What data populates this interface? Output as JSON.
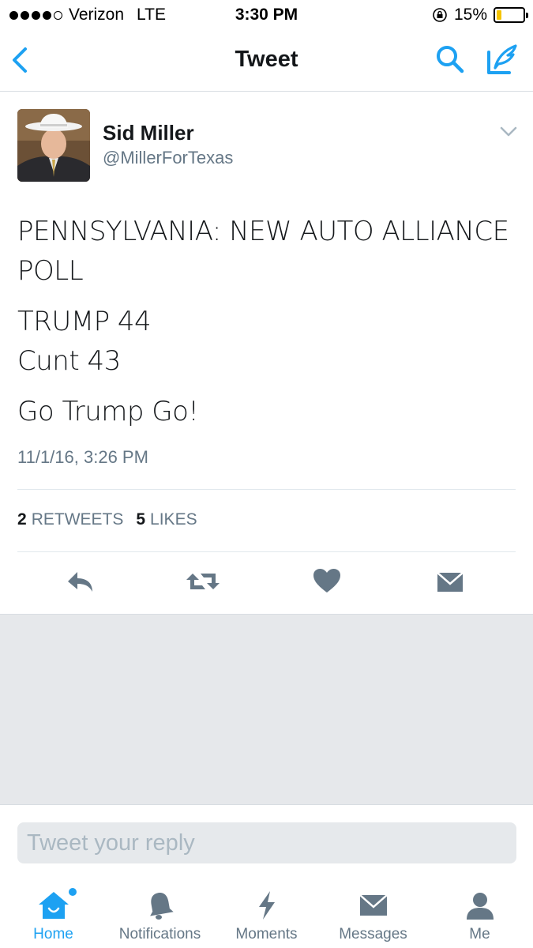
{
  "status_bar": {
    "carrier": "Verizon",
    "network": "LTE",
    "time": "3:30 PM",
    "battery": "15%",
    "battery_level": 0.15,
    "signal_bars": 4
  },
  "nav": {
    "title": "Tweet",
    "icons": [
      "back-chevron-icon",
      "search-icon",
      "compose-icon"
    ]
  },
  "tweet": {
    "author_name": "Sid Miller",
    "author_handle": "@MillerForTexas",
    "text_lines": [
      "PENNSYLVANIA: NEW AUTO ALLIANCE POLL",
      "TRUMP 44\nCunt 43",
      "Go Trump Go!"
    ],
    "timestamp": "11/1/16, 3:26 PM",
    "retweets_count": "2",
    "retweets_label": "RETWEETS",
    "likes_count": "5",
    "likes_label": "LIKES"
  },
  "reply": {
    "placeholder": "Tweet your reply"
  },
  "tab_bar": {
    "tabs": [
      {
        "label": "Home",
        "icon": "home-icon",
        "active": true
      },
      {
        "label": "Notifications",
        "icon": "bell-icon",
        "active": false
      },
      {
        "label": "Moments",
        "icon": "lightning-icon",
        "active": false
      },
      {
        "label": "Messages",
        "icon": "envelope-icon",
        "active": false
      },
      {
        "label": "Me",
        "icon": "person-icon",
        "active": false
      }
    ]
  },
  "colors": {
    "accent": "#1da1f2",
    "text_primary": "#14171a",
    "text_secondary": "#657786",
    "action_icon": "#657786",
    "background": "#e6e8eb"
  }
}
